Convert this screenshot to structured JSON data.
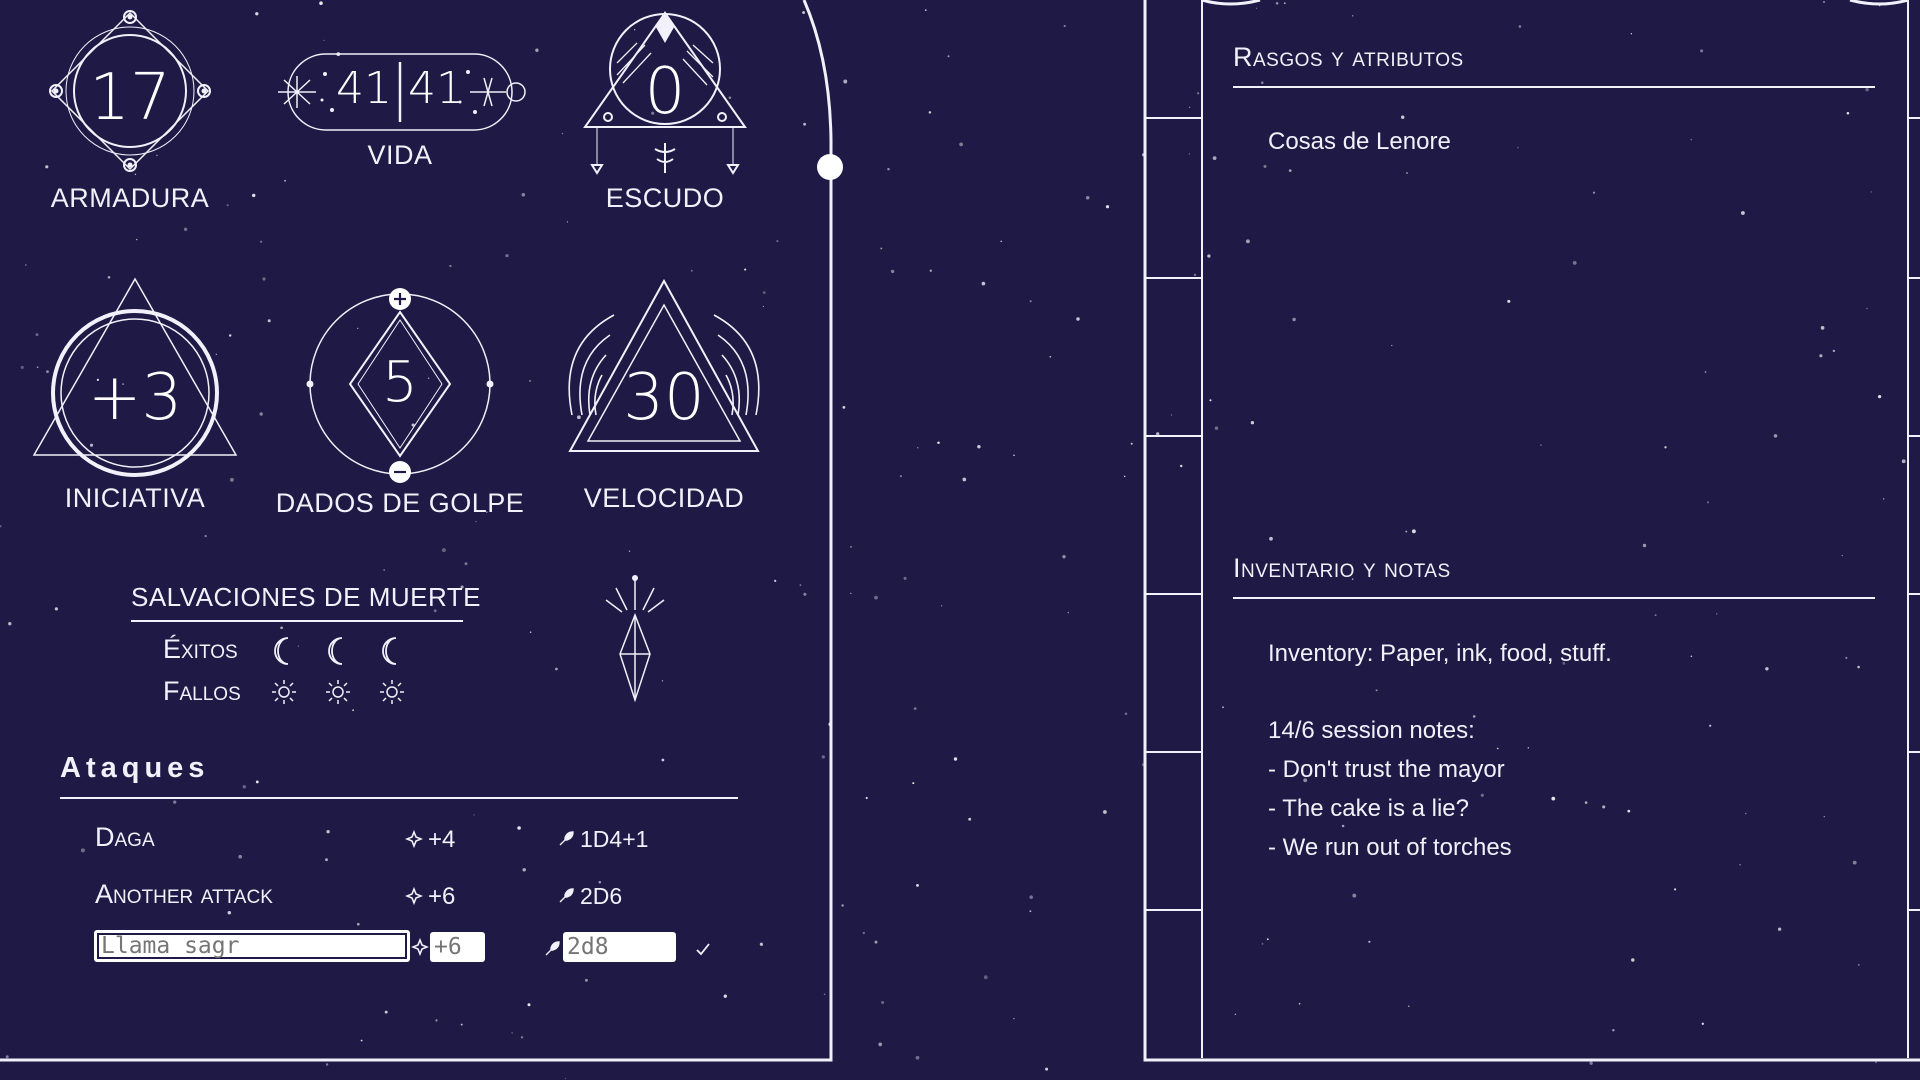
{
  "stats": {
    "armor": {
      "label": "ARMADURA",
      "value": "17"
    },
    "health": {
      "label": "VIDA",
      "current": "41",
      "max": "41"
    },
    "shield": {
      "label": "ESCUDO",
      "value": "0"
    },
    "initiative": {
      "label": "INICIATIVA",
      "value": "+3"
    },
    "hit_dice": {
      "label": "DADOS DE GOLPE",
      "value": "5"
    },
    "speed": {
      "label": "VELOCIDAD",
      "value": "30"
    }
  },
  "death_saves": {
    "title": "SALVACIONES DE MUERTE",
    "successes_label": "Éxitos",
    "failures_label": "Fallos"
  },
  "attacks": {
    "title": "Ataques",
    "rows": [
      {
        "name": "Daga",
        "bonus": "+4",
        "damage": "1D4+1"
      },
      {
        "name": "Another attack",
        "bonus": "+6",
        "damage": "2D6"
      }
    ],
    "new_row": {
      "name_placeholder": "Llama sagr",
      "bonus_placeholder": "+6",
      "damage_placeholder": "2d8"
    }
  },
  "traits": {
    "title": "Rasgos y atributos",
    "text": "Cosas de Lenore"
  },
  "inventory": {
    "title": "Inventario y notas",
    "lines": [
      "Inventory: Paper, ink, food, stuff.",
      "",
      "14/6 session notes:",
      "- Don't trust the mayor",
      "- The cake is a lie?",
      "- We run out of torches"
    ]
  },
  "icons": {
    "attack_bonus": "sparkle-icon",
    "damage": "feather-icon",
    "success": "crescent-moon-icon",
    "failure": "sun-icon",
    "confirm": "check-icon"
  },
  "colors": {
    "background": "#1e1945",
    "line": "#f2f0fa"
  }
}
